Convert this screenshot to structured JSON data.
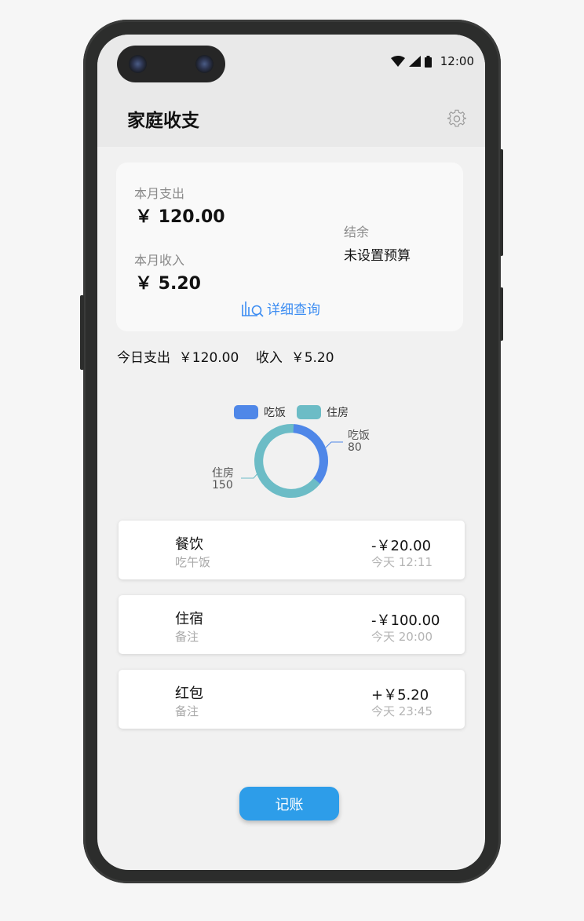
{
  "status_bar": {
    "time": "12:00"
  },
  "header": {
    "title": "家庭收支",
    "settings_icon": "gear-icon"
  },
  "summary": {
    "expense_label": "本月支出",
    "expense_amount": "￥ 120.00",
    "income_label": "本月收入",
    "income_amount": "￥ 5.20",
    "balance_label": "结余",
    "budget_text": "未设置预算",
    "detail_link": "详细查询"
  },
  "today": {
    "text": "今日支出  ￥120.00    收入  ￥5.20"
  },
  "chart_data": {
    "type": "pie",
    "categories": [
      "吃饭",
      "住房"
    ],
    "values": [
      80,
      150
    ],
    "legend": [
      "吃饭",
      "住房"
    ],
    "colors": [
      "#4f87e8",
      "#6cbcc6"
    ],
    "inner_radius_ratio": 0.8,
    "legend_placement": "top"
  },
  "transactions": [
    {
      "category": "餐饮",
      "note": "吃午饭",
      "amount": "-￥20.00",
      "time": "今天 12:11"
    },
    {
      "category": "住宿",
      "note": "备注",
      "amount": "-￥100.00",
      "time": "今天 20:00"
    },
    {
      "category": "红包",
      "note": "备注",
      "amount": "+￥5.20",
      "time": "今天 23:45"
    }
  ],
  "record_button": "记账"
}
